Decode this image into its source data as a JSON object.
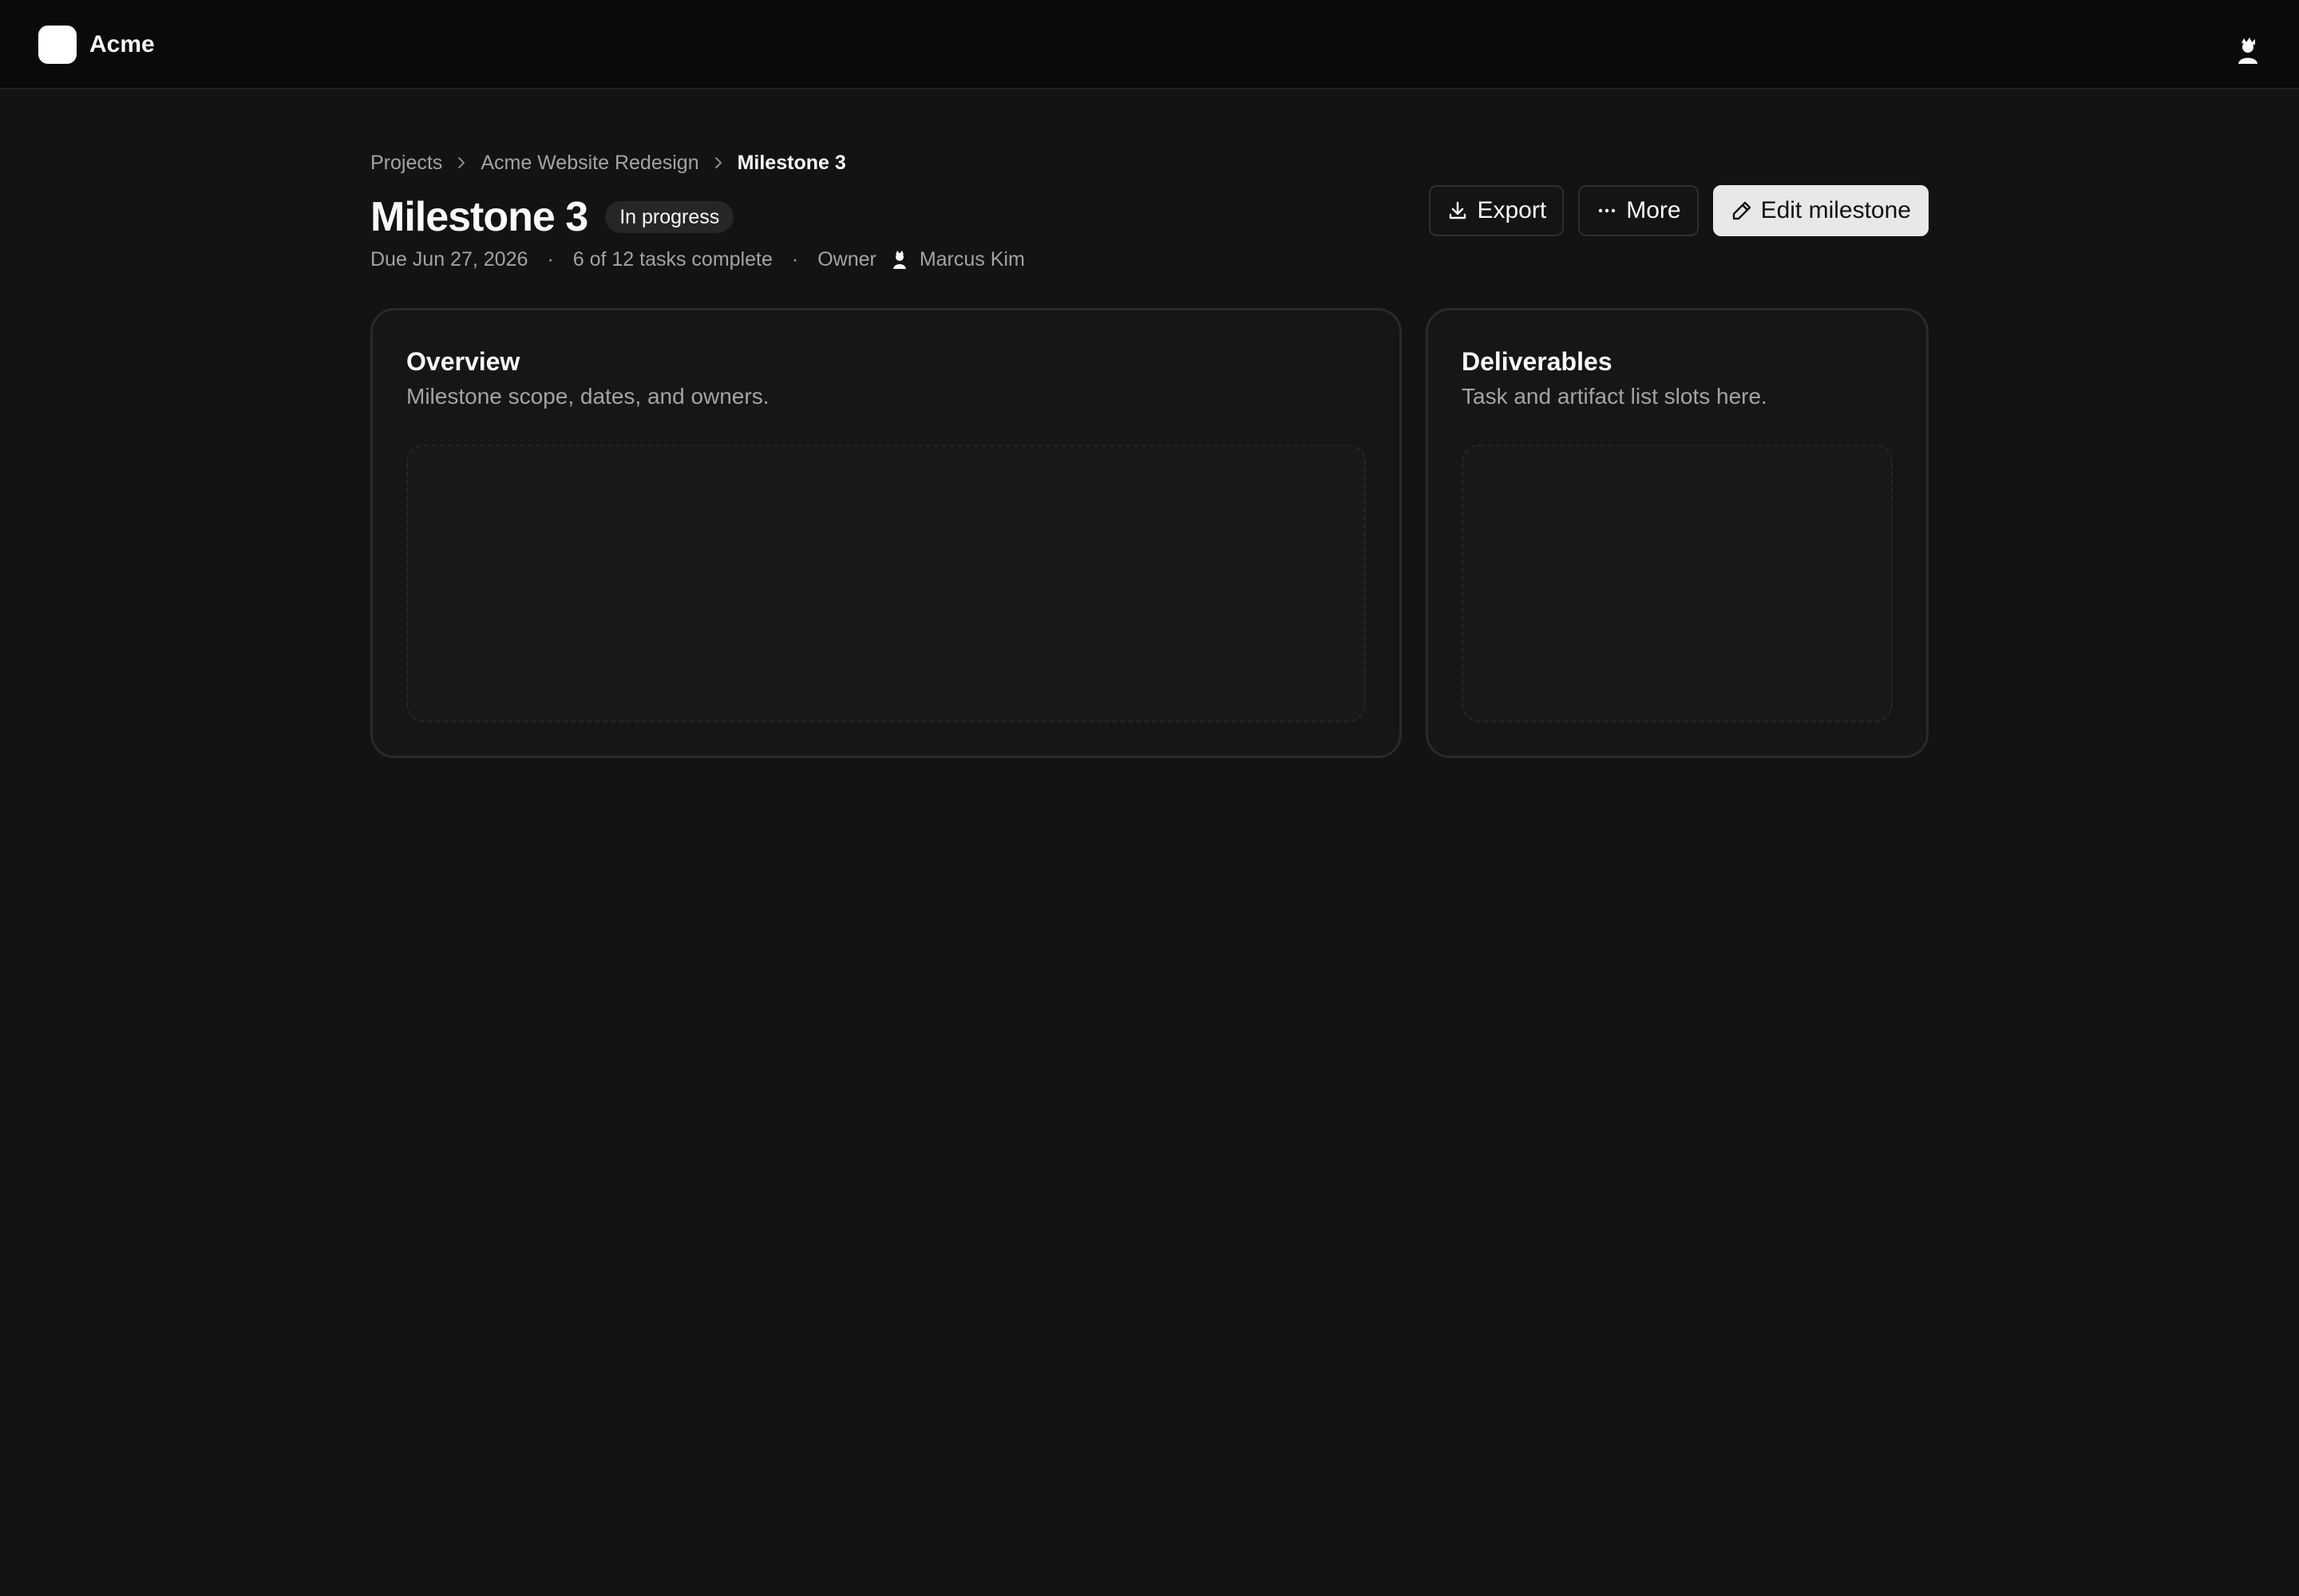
{
  "app": {
    "name": "Acme"
  },
  "breadcrumb": [
    "Projects",
    "Acme Website Redesign",
    "Milestone 3"
  ],
  "page": {
    "title": "Milestone 3",
    "status": "In progress",
    "due": "Due Jun 27, 2026",
    "progress_text": "6 of 12 tasks complete",
    "owner_label": "Owner",
    "owner_name": "Marcus Kim",
    "meta_separator": "·"
  },
  "actions": {
    "export": "Export",
    "more": "More",
    "edit": "Edit milestone"
  },
  "cards": {
    "overview": {
      "title": "Overview",
      "subtitle": "Milestone scope, dates, and owners."
    },
    "deliverables": {
      "title": "Deliverables",
      "subtitle": "Task and artifact list slots here."
    }
  },
  "icons": {
    "logo": "app-logo",
    "user": "user-avatar-icon",
    "breadcrumb_separator": "chevron-right-icon",
    "export": "download-icon",
    "more": "ellipsis-icon",
    "edit": "pencil-icon"
  },
  "colors": {
    "background": "#131313",
    "topbar": "#0a0a0a",
    "card": "#161616",
    "badge": "#262626",
    "primary_button": "#e8e8e8",
    "muted_text": "#a3a3a3"
  }
}
